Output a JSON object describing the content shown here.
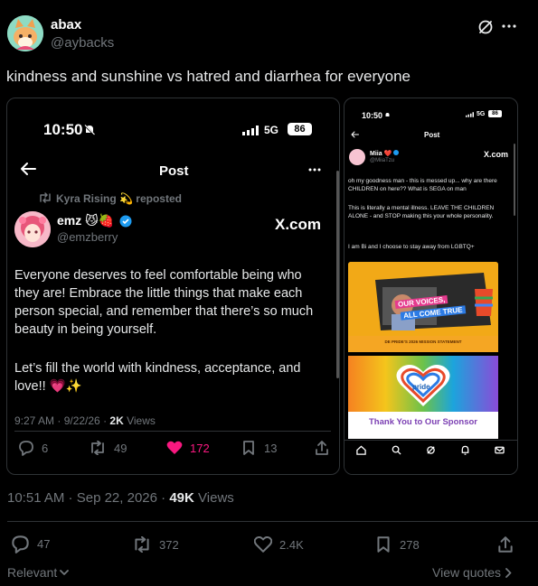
{
  "tweet": {
    "name": "abax",
    "handle": "@aybacks",
    "text": "kindness and sunshine vs hatred and diarrhea for everyone",
    "time": "10:51 AM",
    "date": "Sep 22, 2026",
    "views_count": "49K",
    "views_label": "Views",
    "stats": {
      "replies": "47",
      "reposts": "372",
      "likes": "2.4K",
      "bookmarks": "278"
    },
    "relevant_label": "Relevant",
    "view_quotes_label": "View quotes"
  },
  "left_shot": {
    "status_time": "10:50",
    "signal_label": "5G",
    "battery": "86",
    "header_title": "Post",
    "repost_by": "Kyra Rising",
    "repost_suffix": "reposted",
    "author_name": "emz",
    "author_handle": "@emzberry",
    "watermark": "X.com",
    "para1": "Everyone deserves to feel comfortable being who they are! Embrace the little things that make each person special, and remember that there’s so much beauty in being yourself.",
    "para2": "Let’s fill the world with kindness, acceptance, and love!! 💗✨",
    "meta_time": "9:27 AM · 9/22/26 · ",
    "meta_views_count": "2K",
    "meta_views_label": "Views",
    "stats": {
      "replies": "6",
      "reposts": "49",
      "likes": "172",
      "bookmarks": "13"
    },
    "like_color": "#f91880"
  },
  "right_shot": {
    "status_time": "10:50",
    "signal_label": "5G",
    "battery": "86",
    "header_title": "Post",
    "author_name": "Miia",
    "author_handle": "@MiiaTzu",
    "watermark": "X.com",
    "line1": "oh my goodness man - this is messed up... why are there CHILDREN on here?? What is SEGA on man",
    "line2": "This is literally a mental illness. LEAVE THE CHILDREN ALONE - and STOP making this your whole personality.",
    "line3": "I am Bi and I choose to stay away from LGBTQ+",
    "image_text_1": "OUR VOICES,",
    "image_text_2": "ALL COME TRUE",
    "image_caption": "DE PRIDE'S 2026 MISSION STATEMENT",
    "sponsor_text": "Thank You to Our Sponsor",
    "pride_label": "pride"
  },
  "colors": {
    "accent": "#1d9bf0",
    "like": "#f91880",
    "muted": "#71767b",
    "border": "#2f3336"
  }
}
